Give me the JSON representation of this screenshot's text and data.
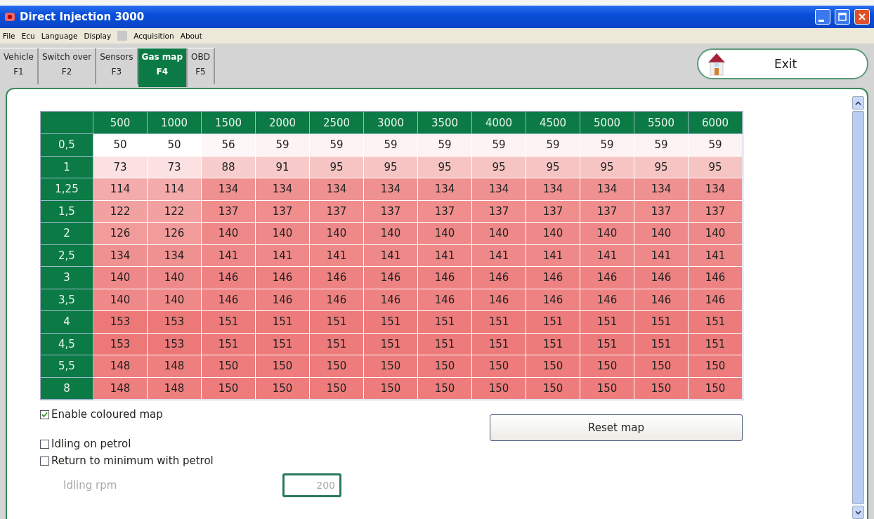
{
  "window": {
    "title": "Direct Injection 3000"
  },
  "menu": [
    "File",
    "Ecu",
    "Language",
    "Display",
    "Acquisition",
    "About"
  ],
  "tabs": [
    {
      "label": "Vehicle",
      "key": "F1",
      "selected": false
    },
    {
      "label": "Switch over",
      "key": "F2",
      "selected": false
    },
    {
      "label": "Sensors",
      "key": "F3",
      "selected": false
    },
    {
      "label": "Gas map",
      "key": "F4",
      "selected": true
    },
    {
      "label": "OBD",
      "key": "F5",
      "selected": false
    }
  ],
  "exit_button": "Exit",
  "table": {
    "columns": [
      "500",
      "1000",
      "1500",
      "2000",
      "2500",
      "3000",
      "3500",
      "4000",
      "4500",
      "5000",
      "5500",
      "6000"
    ],
    "rows": [
      {
        "label": "0,5",
        "cells": [
          "50",
          "50",
          "56",
          "59",
          "59",
          "59",
          "59",
          "59",
          "59",
          "59",
          "59",
          "59"
        ]
      },
      {
        "label": "1",
        "cells": [
          "73",
          "73",
          "88",
          "91",
          "95",
          "95",
          "95",
          "95",
          "95",
          "95",
          "95",
          "95"
        ]
      },
      {
        "label": "1,25",
        "cells": [
          "114",
          "114",
          "134",
          "134",
          "134",
          "134",
          "134",
          "134",
          "134",
          "134",
          "134",
          "134"
        ]
      },
      {
        "label": "1,5",
        "cells": [
          "122",
          "122",
          "137",
          "137",
          "137",
          "137",
          "137",
          "137",
          "137",
          "137",
          "137",
          "137"
        ]
      },
      {
        "label": "2",
        "cells": [
          "126",
          "126",
          "140",
          "140",
          "140",
          "140",
          "140",
          "140",
          "140",
          "140",
          "140",
          "140"
        ]
      },
      {
        "label": "2,5",
        "cells": [
          "134",
          "134",
          "141",
          "141",
          "141",
          "141",
          "141",
          "141",
          "141",
          "141",
          "141",
          "141"
        ]
      },
      {
        "label": "3",
        "cells": [
          "140",
          "140",
          "146",
          "146",
          "146",
          "146",
          "146",
          "146",
          "146",
          "146",
          "146",
          "146"
        ]
      },
      {
        "label": "3,5",
        "cells": [
          "140",
          "140",
          "146",
          "146",
          "146",
          "146",
          "146",
          "146",
          "146",
          "146",
          "146",
          "146"
        ]
      },
      {
        "label": "4",
        "cells": [
          "153",
          "153",
          "151",
          "151",
          "151",
          "151",
          "151",
          "151",
          "151",
          "151",
          "151",
          "151"
        ]
      },
      {
        "label": "4,5",
        "cells": [
          "153",
          "153",
          "151",
          "151",
          "151",
          "151",
          "151",
          "151",
          "151",
          "151",
          "151",
          "151"
        ]
      },
      {
        "label": "5,5",
        "cells": [
          "148",
          "148",
          "150",
          "150",
          "150",
          "150",
          "150",
          "150",
          "150",
          "150",
          "150",
          "150"
        ]
      },
      {
        "label": "8",
        "cells": [
          "148",
          "148",
          "150",
          "150",
          "150",
          "150",
          "150",
          "150",
          "150",
          "150",
          "150",
          "150"
        ]
      }
    ]
  },
  "options": [
    {
      "label": "Enable coloured map",
      "checked": true
    },
    {
      "label": "Idling on petrol",
      "checked": false
    },
    {
      "label": "Return to minimum with petrol",
      "checked": false
    }
  ],
  "reset_button": "Reset map",
  "idling_rpm": {
    "label": "Idling rpm",
    "value": "200",
    "disabled": true
  }
}
